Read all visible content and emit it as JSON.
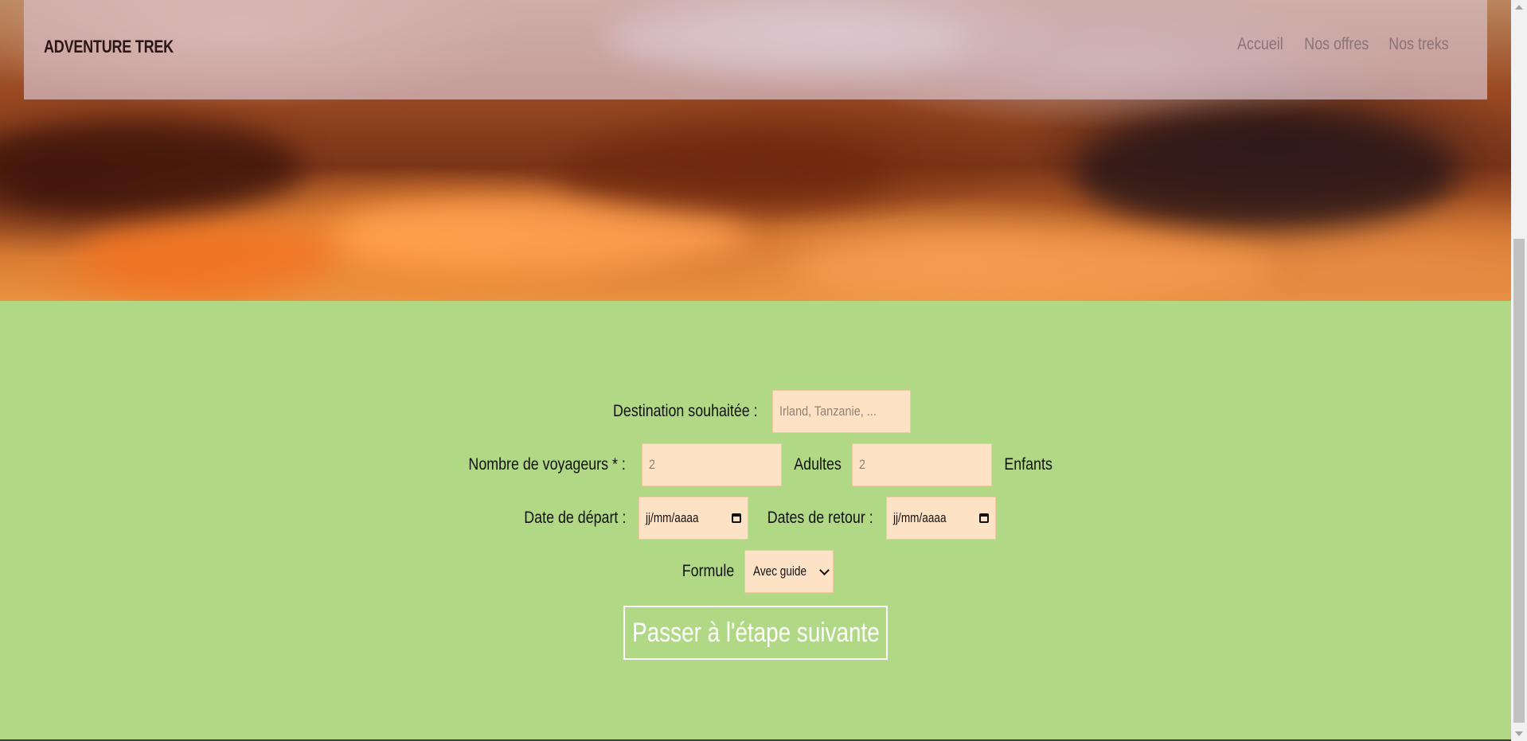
{
  "header": {
    "brand": "ADVENTURE TREK",
    "nav": [
      {
        "label": "Accueil"
      },
      {
        "label": "Nos offres"
      },
      {
        "label": "Nos treks"
      }
    ]
  },
  "form": {
    "destination_label": "Destination souhaitée :",
    "destination_placeholder": "Irland, Tanzanie, ...",
    "travelers_label": "Nombre de voyageurs * :",
    "adults_value": "2",
    "adults_label": "Adultes",
    "children_value": "2",
    "children_label": "Enfants",
    "departure_label": "Date de départ :",
    "departure_placeholder": "jj/mm/aaaa",
    "return_label": "Dates de retour :",
    "return_placeholder": "jj/mm/aaaa",
    "formula_label": "Formule",
    "formula_selected": "Avec guide",
    "submit_label": "Passer à l'étape suivante"
  },
  "icons": {
    "calendar": "calendar-icon",
    "dropdown": "chevron-down-icon"
  },
  "colors": {
    "form_background": "#b1d985",
    "input_background": "#fde2c5",
    "submit_border": "#ffffff"
  }
}
